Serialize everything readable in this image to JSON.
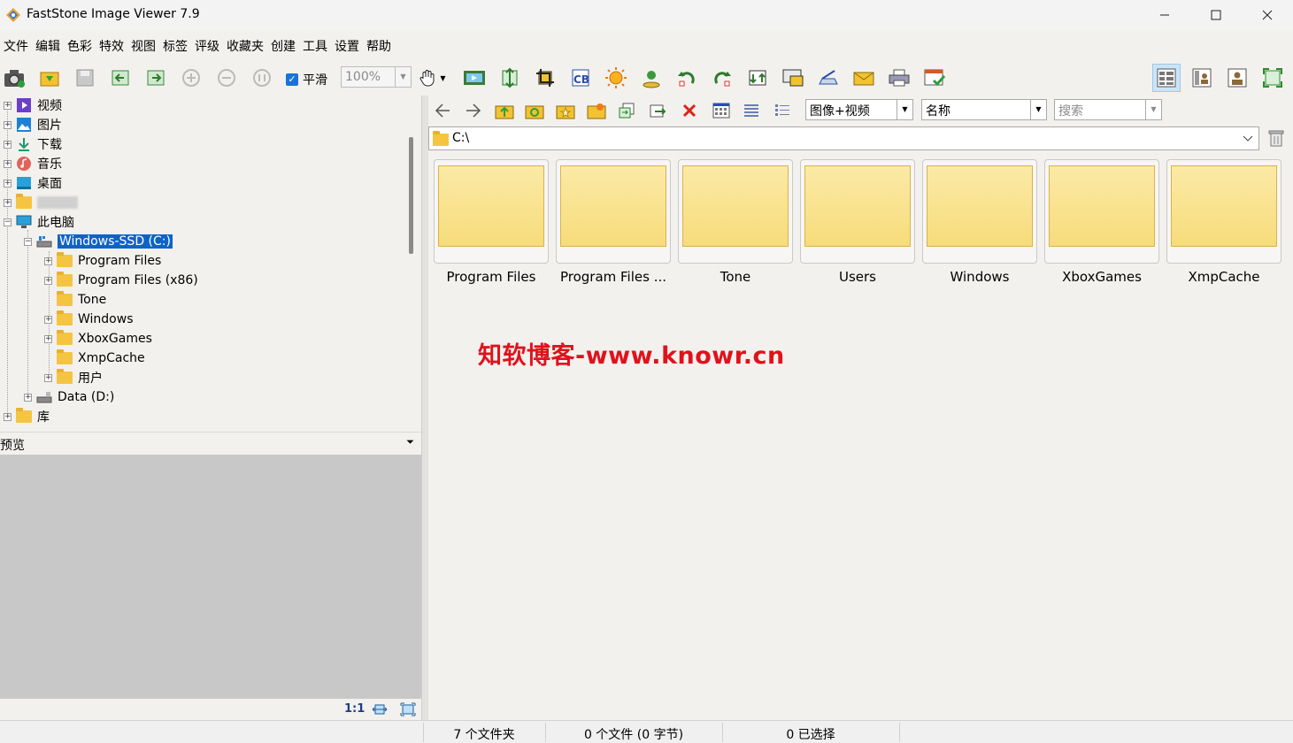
{
  "window": {
    "title": "FastStone Image Viewer 7.9",
    "controls": [
      "minimize-icon",
      "maximize-icon",
      "close-icon"
    ]
  },
  "menu": [
    "文件",
    "编辑",
    "色彩",
    "特效",
    "视图",
    "标签",
    "评级",
    "收藏夹",
    "创建",
    "工具",
    "设置",
    "帮助"
  ],
  "toolbar": {
    "smooth_label": "平滑",
    "smooth_checked": true,
    "zoom_value": "100%"
  },
  "tree": {
    "items": [
      {
        "label": "视频",
        "icon": "video-icon"
      },
      {
        "label": "图片",
        "icon": "picture-icon"
      },
      {
        "label": "下载",
        "icon": "download-icon"
      },
      {
        "label": "音乐",
        "icon": "music-icon"
      },
      {
        "label": "桌面",
        "icon": "desktop-icon"
      },
      {
        "label": "",
        "icon": "folder-icon"
      },
      {
        "label": "此电脑",
        "icon": "computer-icon"
      },
      {
        "label": "Windows-SSD (C:)",
        "icon": "drive-icon"
      },
      {
        "label": "Program Files",
        "icon": "folder-icon"
      },
      {
        "label": "Program Files (x86)",
        "icon": "folder-icon"
      },
      {
        "label": "Tone",
        "icon": "folder-icon"
      },
      {
        "label": "Windows",
        "icon": "folder-icon"
      },
      {
        "label": "XboxGames",
        "icon": "folder-icon"
      },
      {
        "label": "XmpCache",
        "icon": "folder-icon"
      },
      {
        "label": "用户",
        "icon": "folder-icon"
      },
      {
        "label": "Data (D:)",
        "icon": "drive-icon"
      },
      {
        "label": "库",
        "icon": "folder-icon"
      }
    ]
  },
  "preview": {
    "label": "预览",
    "ratio": "1:1"
  },
  "browser": {
    "filter": "图像+视频",
    "sort": "名称",
    "search_placeholder": "搜索",
    "path": "C:\\",
    "folders": [
      "Program Files",
      "Program Files ...",
      "Tone",
      "Users",
      "Windows",
      "XboxGames",
      "XmpCache"
    ],
    "watermark": "知软博客-www.knowr.cn"
  },
  "status": {
    "folders": "7 个文件夹",
    "files": "0 个文件 (0 字节)",
    "selected": "0 已选择"
  },
  "colors": {
    "selection": "#0f63c6",
    "folder": "#f5c542",
    "watermark": "#e0121b"
  }
}
